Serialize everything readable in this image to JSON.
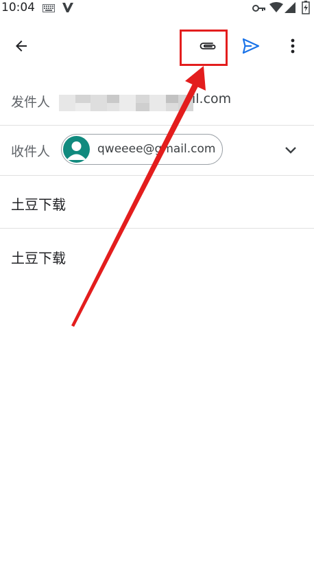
{
  "status_bar": {
    "time": "10:04",
    "icons": [
      "keyboard-icon",
      "v-app-icon",
      "key-icon",
      "wifi-icon",
      "signal-icon",
      "battery-icon"
    ]
  },
  "toolbar": {
    "icons": [
      "back-arrow-icon",
      "paperclip-icon",
      "send-icon",
      "more-vert-icon"
    ],
    "accent_color": "#1a73e8"
  },
  "compose": {
    "from_label": "发件人",
    "from_value_visible": "il.com",
    "to_label": "收件人",
    "to_chip_email": "qweeee@gmail.com",
    "subject": "土豆下载",
    "body": "土豆下载"
  },
  "annotation": {
    "color": "#e31d1d"
  }
}
